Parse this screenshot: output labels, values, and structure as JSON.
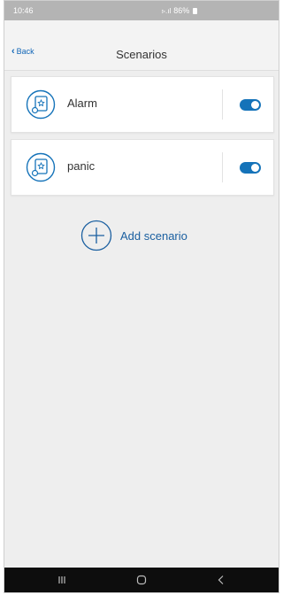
{
  "status_bar": {
    "time": "10:46",
    "right_text": "86%",
    "icons": "signal-wifi-icons"
  },
  "header": {
    "back_label": "Back",
    "title": "Scenarios"
  },
  "scenarios": [
    {
      "label": "Alarm",
      "icon": "scenario-icon",
      "enabled": true
    },
    {
      "label": "panic",
      "icon": "scenario-icon",
      "enabled": true
    }
  ],
  "add_scenario": {
    "label": "Add scenario",
    "icon": "plus-circle-icon"
  },
  "system_nav": {
    "recents": "recents-icon",
    "home": "home-icon",
    "back": "back-icon"
  },
  "colors": {
    "accent": "#1573b9",
    "link": "#1a5fa0",
    "status_bar": "#b4b4b4",
    "background": "#eeeeee",
    "nav_bar": "#0d0d0d"
  }
}
